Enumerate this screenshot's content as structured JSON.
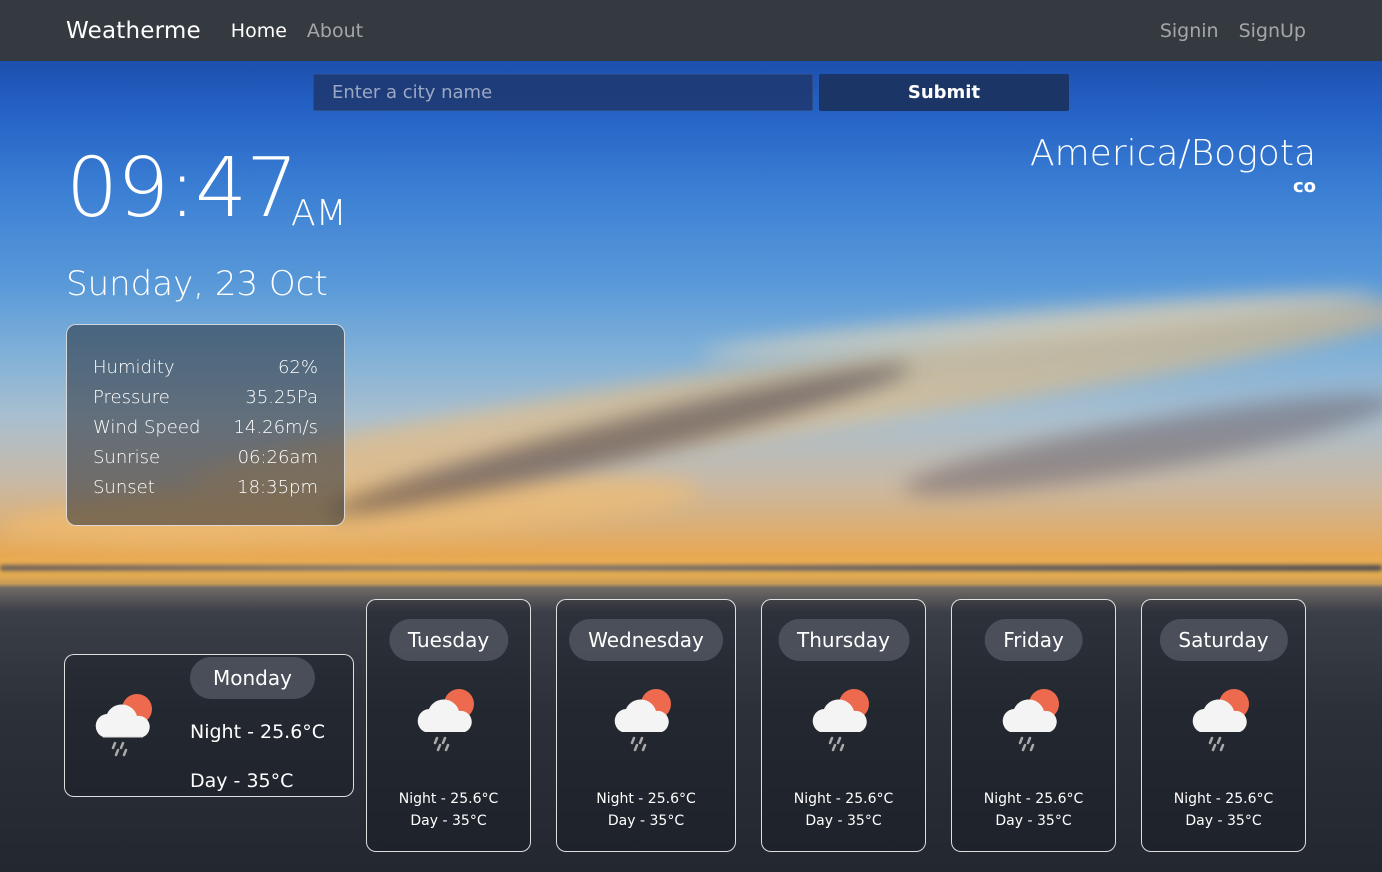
{
  "navbar": {
    "brand": "Weatherme",
    "links": [
      "Home",
      "About"
    ],
    "right_links": [
      "Signin",
      "SignUp"
    ]
  },
  "search": {
    "placeholder": "Enter a city name",
    "value": "",
    "submit_label": "Submit"
  },
  "clock": {
    "time": "09:47",
    "ampm": "AM",
    "date": "Sunday, 23 Oct"
  },
  "location": {
    "city": "America/Bogota",
    "country": "co"
  },
  "details": [
    {
      "label": "Humidity",
      "value": "62%"
    },
    {
      "label": "Pressure",
      "value": "35.25Pa"
    },
    {
      "label": "Wind Speed",
      "value": "14.26m/s"
    },
    {
      "label": "Sunrise",
      "value": "06:26am"
    },
    {
      "label": "Sunset",
      "value": "18:35pm"
    }
  ],
  "today": {
    "day": "Monday",
    "night": "Night - 25.6°C",
    "daytemp": "Day - 35°C",
    "icon": "rain-cloud-sun-icon"
  },
  "forecast": [
    {
      "day": "Tuesday",
      "night": "Night - 25.6°C",
      "daytemp": "Day - 35°C",
      "icon": "rain-cloud-sun-icon"
    },
    {
      "day": "Wednesday",
      "night": "Night - 25.6°C",
      "daytemp": "Day - 35°C",
      "icon": "rain-cloud-sun-icon"
    },
    {
      "day": "Thursday",
      "night": "Night - 25.6°C",
      "daytemp": "Day - 35°C",
      "icon": "rain-cloud-sun-icon"
    },
    {
      "day": "Friday",
      "night": "Night - 25.6°C",
      "daytemp": "Day - 35°C",
      "icon": "rain-cloud-sun-icon"
    },
    {
      "day": "Saturday",
      "night": "Night - 25.6°C",
      "daytemp": "Day - 35°C",
      "icon": "rain-cloud-sun-icon"
    }
  ],
  "colors": {
    "navbar": "#343a40",
    "submit": "#1b3566",
    "sun": "#ee6a4f"
  }
}
